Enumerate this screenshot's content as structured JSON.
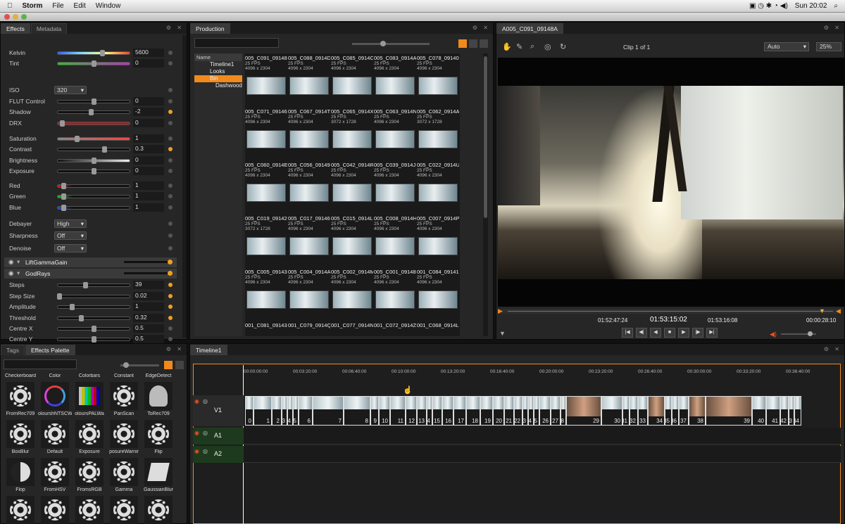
{
  "menubar": {
    "app": "Storm",
    "items": [
      "File",
      "Edit",
      "Window"
    ],
    "clock": "Sun 20:02"
  },
  "effects_panel": {
    "tabs": [
      "Effects",
      "Metadata"
    ],
    "params": [
      {
        "label": "Kelvin",
        "value": "5600",
        "level": 0.62,
        "type": "slider",
        "active": false
      },
      {
        "label": "Tint",
        "value": "0",
        "level": 0.5,
        "type": "slider",
        "active": false
      },
      {
        "label": "ISO",
        "value": "320",
        "type": "dropdown"
      },
      {
        "label": "FLUT Control",
        "value": "0",
        "level": 0.5,
        "type": "slider",
        "active": false
      },
      {
        "label": "Shadow",
        "value": "-2",
        "level": 0.46,
        "type": "slider",
        "active": true
      },
      {
        "label": "DRX",
        "value": "0",
        "level": 0.06,
        "type": "slider",
        "active": false
      },
      {
        "label": "Saturation",
        "value": "1",
        "level": 0.26,
        "type": "slider",
        "active": false
      },
      {
        "label": "Contrast",
        "value": "0.3",
        "level": 0.65,
        "type": "slider",
        "active": true
      },
      {
        "label": "Brightness",
        "value": "0",
        "level": 0.5,
        "type": "slider",
        "active": false
      },
      {
        "label": "Exposure",
        "value": "0",
        "level": 0.5,
        "type": "slider",
        "active": false
      },
      {
        "label": "Red",
        "value": "1",
        "level": 0.08,
        "type": "slider",
        "active": false
      },
      {
        "label": "Green",
        "value": "1",
        "level": 0.08,
        "type": "slider",
        "active": false
      },
      {
        "label": "Blue",
        "value": "1",
        "level": 0.08,
        "type": "slider",
        "active": false
      },
      {
        "label": "Debayer",
        "value": "High",
        "type": "dropdown"
      },
      {
        "label": "Sharpness",
        "value": "Off",
        "type": "dropdown"
      },
      {
        "label": "Denoise",
        "value": "Off",
        "type": "dropdown"
      }
    ],
    "groups": [
      "LiftGammaGain",
      "GodRays"
    ],
    "godrays": [
      {
        "label": "Steps",
        "value": "39",
        "level": 0.38
      },
      {
        "label": "Step Size",
        "value": "0.02",
        "level": 0.02
      },
      {
        "label": "Amplitude",
        "value": "1",
        "level": 0.2
      },
      {
        "label": "Threshold",
        "value": "0.32",
        "level": 0.32
      },
      {
        "label": "Centre X",
        "value": "0.5",
        "level": 0.5
      },
      {
        "label": "Centre Y",
        "value": "0.5",
        "level": 0.5
      }
    ]
  },
  "production": {
    "tab": "Production",
    "tree_header": "Name",
    "tree": [
      "Timeline1",
      "Looks",
      "Bin",
      "Dashwood"
    ],
    "clips": [
      {
        "name": "005_C091_09148",
        "fps": "25 FPS",
        "res": "4096 x 2304"
      },
      {
        "name": "005_C088_0914D",
        "fps": "25 FPS",
        "res": "4096 x 2304"
      },
      {
        "name": "005_C085_0914C",
        "fps": "25 FPS",
        "res": "4096 x 2304"
      },
      {
        "name": "005_C083_0914A",
        "fps": "25 FPS",
        "res": "4096 x 2304"
      },
      {
        "name": "005_C078_09140I",
        "fps": "25 FPS",
        "res": "4096 x 2304"
      },
      {
        "name": "005_C071_09146",
        "fps": "25 FPS",
        "res": "4096 x 2304"
      },
      {
        "name": "005_C067_0914T",
        "fps": "25 FPS",
        "res": "4096 x 2304"
      },
      {
        "name": "005_C065_0914X",
        "fps": "25 FPS",
        "res": "3072 x 1728"
      },
      {
        "name": "005_C063_0914N",
        "fps": "25 FPS",
        "res": "4096 x 2304"
      },
      {
        "name": "005_C062_0914A",
        "fps": "25 FPS",
        "res": "3072 x 1728"
      },
      {
        "name": "005_C060_0914E",
        "fps": "25 FPS",
        "res": "4096 x 2304"
      },
      {
        "name": "005_C056_09149",
        "fps": "25 FPS",
        "res": "4096 x 2304"
      },
      {
        "name": "005_C042_0914R",
        "fps": "25 FPS",
        "res": "4096 x 2304"
      },
      {
        "name": "005_C039_0914J",
        "fps": "25 FPS",
        "res": "4096 x 2304"
      },
      {
        "name": "005_C022_0914U",
        "fps": "25 FPS",
        "res": "4096 x 2304"
      },
      {
        "name": "005_C019_09142",
        "fps": "25 FPS",
        "res": "3072 x 1728"
      },
      {
        "name": "005_C017_09146",
        "fps": "25 FPS",
        "res": "4096 x 2304"
      },
      {
        "name": "005_C015_0914L",
        "fps": "25 FPS",
        "res": "4096 x 2304"
      },
      {
        "name": "005_C008_0914H",
        "fps": "25 FPS",
        "res": "4096 x 2304"
      },
      {
        "name": "005_C007_0914P",
        "fps": "25 FPS",
        "res": "4096 x 2304"
      },
      {
        "name": "005_C005_09143",
        "fps": "25 FPS",
        "res": "4096 x 2304"
      },
      {
        "name": "005_C004_0914A",
        "fps": "25 FPS",
        "res": "4096 x 2304"
      },
      {
        "name": "005_C002_0914M",
        "fps": "25 FPS",
        "res": "4096 x 2304"
      },
      {
        "name": "005_C001_09148",
        "fps": "25 FPS",
        "res": "4096 x 2304"
      },
      {
        "name": "001_C084_09141",
        "fps": "25 FPS",
        "res": "4096 x 2304"
      },
      {
        "name": "001_C081_09143",
        "fps": "",
        "res": ""
      },
      {
        "name": "001_C079_0914Q",
        "fps": "",
        "res": ""
      },
      {
        "name": "001_C077_0914N",
        "fps": "",
        "res": ""
      },
      {
        "name": "001_C072_0914Z",
        "fps": "",
        "res": ""
      },
      {
        "name": "001_C068_0914L",
        "fps": "",
        "res": ""
      }
    ]
  },
  "viewer": {
    "tab": "A005_C091_09148A",
    "clip_counter": "Clip 1 of 1",
    "fit": "Auto",
    "zoom": "25%",
    "playhead_fraction": 0.0,
    "timecode_in": "01:52:47:24",
    "timecode_current": "01:53:15:02",
    "timecode_out": "01:53:16:08",
    "duration": "00:00:28:10"
  },
  "palette": {
    "tabs": [
      "Tags",
      "Effects Palette"
    ],
    "effects": [
      "Checkerboard",
      "Color",
      "Colorbars",
      "Constant",
      "EdgeDetect",
      "FromRec709",
      "olourshNTSCWi",
      "oloursPALWa",
      "PanScan",
      "ToRec709",
      "BoxBlur",
      "Default",
      "Exposure",
      "posureWarnir",
      "Flip",
      "Flop",
      "FromHSV",
      "FromsRGB",
      "Gamma",
      "GaussianBlur"
    ]
  },
  "timeline": {
    "tab": "Timeline1",
    "ticks": [
      "00:00:00:00",
      "00:03:20:00",
      "00:06:40:00",
      "00:10:00:00",
      "00:13:20:00",
      "00:16:40:00",
      "00:20:00:00",
      "00:23:20:00",
      "00:26:40:00",
      "00:30:00:00",
      "00:33:20:00",
      "00:36:40:00"
    ],
    "tracks": [
      "V1",
      "A1",
      "A2"
    ],
    "clip_numbers": [
      "0",
      "1",
      "2",
      "3",
      "4",
      "5",
      "6",
      "7",
      "8",
      "9",
      "10",
      "11",
      "12",
      "13",
      "14",
      "15",
      "16",
      "17",
      "18",
      "19",
      "20",
      "21",
      "22",
      "23",
      "24",
      "25",
      "26",
      "27",
      "28",
      "29",
      "30",
      "31",
      "32",
      "33",
      "34",
      "35",
      "36",
      "37",
      "38",
      "39",
      "40",
      "41",
      "42",
      "43",
      "44"
    ]
  },
  "colors": {
    "accent": "#f08a1c",
    "panel": "#262626"
  }
}
